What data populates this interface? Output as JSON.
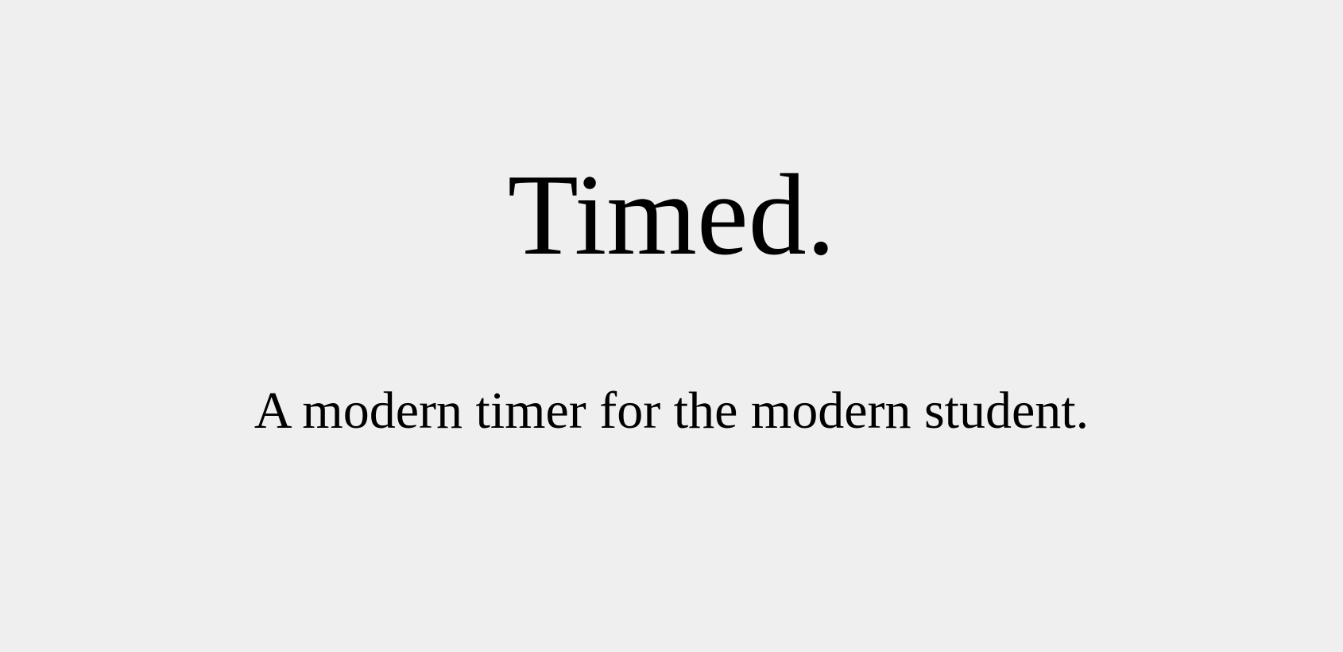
{
  "hero": {
    "title": "Timed.",
    "subtitle": "A modern timer for the modern student."
  },
  "colors": {
    "background": "#efefef",
    "text": "#000000"
  }
}
